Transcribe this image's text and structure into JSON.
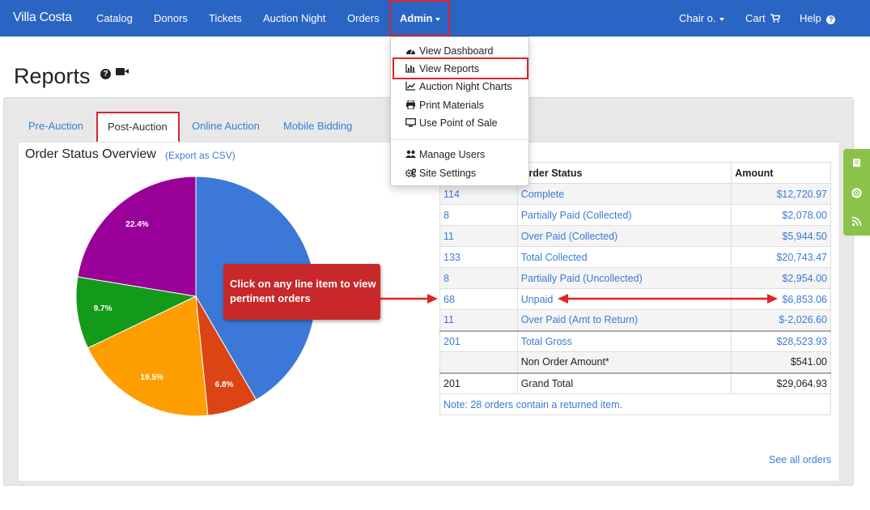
{
  "navbar": {
    "brand": "Villa Costa",
    "items": [
      "Catalog",
      "Donors",
      "Tickets",
      "Auction Night",
      "Orders"
    ],
    "admin": "Admin",
    "chair": "Chair o.",
    "cart": "Cart",
    "help": "Help"
  },
  "page": {
    "title": "Reports"
  },
  "tabs": [
    "Pre-Auction",
    "Post-Auction",
    "Online Auction",
    "Mobile Bidding"
  ],
  "active_tab": "Post-Auction",
  "section": {
    "title": "Order Status Overview",
    "export": "(Export as CSV)"
  },
  "chart_data": {
    "type": "pie",
    "slices": [
      {
        "label": "",
        "value": 41.6,
        "color": "#3c78d8"
      },
      {
        "label": "6.8%",
        "value": 6.8,
        "color": "#dc4414"
      },
      {
        "label": "19.5%",
        "value": 19.5,
        "color": "#ff9e00"
      },
      {
        "label": "9.7%",
        "value": 9.7,
        "color": "#149a1a"
      },
      {
        "label": "22.4%",
        "value": 22.4,
        "color": "#980098"
      }
    ]
  },
  "table": {
    "headers": [
      "Order Status",
      "Amount"
    ],
    "rows": [
      {
        "count": "114",
        "status": "Complete",
        "amount": "$12,720.97"
      },
      {
        "count": "8",
        "status": "Partially Paid (Collected)",
        "amount": "$2,078.00"
      },
      {
        "count": "11",
        "status": "Over Paid (Collected)",
        "amount": "$5,944.50"
      },
      {
        "count": "133",
        "status": "Total Collected",
        "amount": "$20,743.47"
      },
      {
        "count": "8",
        "status": "Partially Paid (Uncollected)",
        "amount": "$2,954.00"
      },
      {
        "count": "68",
        "status": "Unpaid",
        "amount": "$6,853.06"
      },
      {
        "count": "11",
        "status": "Over Paid (Amt to Return)",
        "amount": "$-2,026.60"
      },
      {
        "count": "201",
        "status": "Total Gross",
        "amount": "$28,523.93"
      },
      {
        "count": "",
        "status": "Non Order Amount*",
        "amount": "$541.00"
      },
      {
        "count": "201",
        "status": "Grand Total",
        "amount": "$29,064.93"
      }
    ],
    "note": "Note: 28 orders contain a returned item."
  },
  "see_all": "See all orders",
  "dropdown": {
    "items": [
      "View Dashboard",
      "View Reports",
      "Auction Night Charts",
      "Print Materials",
      "Use Point of Sale",
      "Manage Users",
      "Site Settings"
    ]
  },
  "callout": "Click on any line item to view pertinent orders",
  "colors": {
    "navbar": "#2a65c4",
    "link": "#3a7bd5",
    "highlight": "#d9262a",
    "side_tabs": "#8bc34a"
  }
}
